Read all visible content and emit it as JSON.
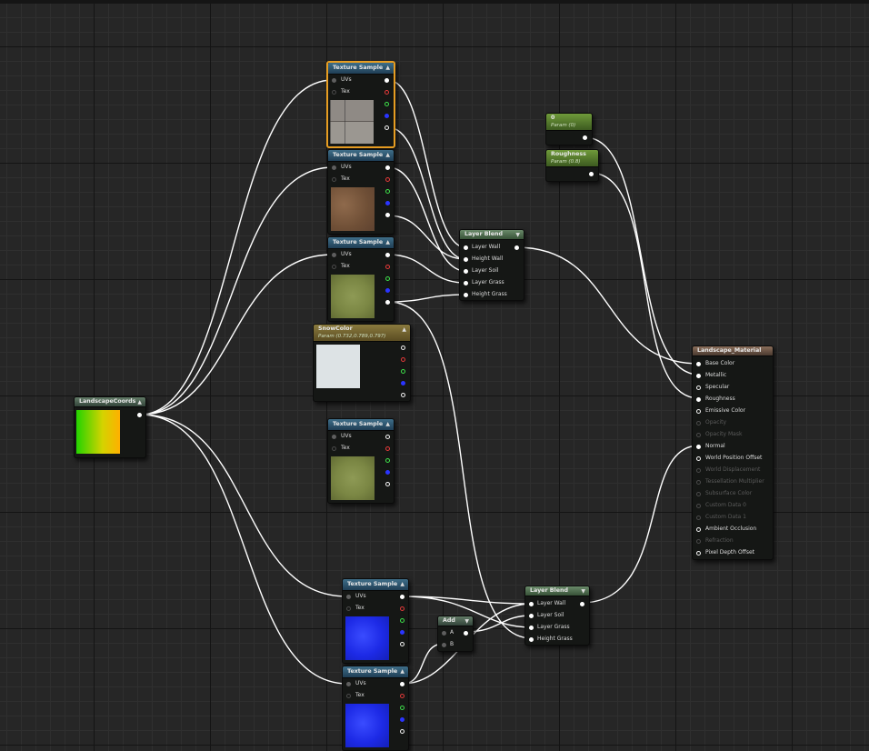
{
  "nodes": {
    "landscape_coords": {
      "title": "LandscapeCoords"
    },
    "texture_sample_label": "Texture Sample",
    "texture_pins": {
      "uvs": "UVs",
      "tex": "Tex"
    },
    "snow_color": {
      "title": "SnowColor",
      "subtitle": "Param (0.732,0.789,0.797)"
    },
    "param_0": {
      "title": "0",
      "subtitle": "Param (0)"
    },
    "roughness": {
      "title": "Roughness",
      "subtitle": "Param (0.8)"
    },
    "layer_blend_top": {
      "title": "Layer Blend",
      "inputs": [
        "Layer Wall",
        "Height Wall",
        "Layer Soil",
        "Layer Grass",
        "Height Grass"
      ]
    },
    "layer_blend_bottom": {
      "title": "Layer Blend",
      "inputs": [
        "Layer Wall",
        "Layer Soil",
        "Layer Grass",
        "Height Grass"
      ]
    },
    "add": {
      "title": "Add",
      "inputs": [
        "A",
        "B"
      ]
    },
    "landscape_material": {
      "title": "Landscape_Material",
      "inputs": [
        {
          "label": "Base Color",
          "active": true
        },
        {
          "label": "Metallic",
          "active": true
        },
        {
          "label": "Specular",
          "active": true
        },
        {
          "label": "Roughness",
          "active": true
        },
        {
          "label": "Emissive Color",
          "active": true
        },
        {
          "label": "Opacity",
          "active": false
        },
        {
          "label": "Opacity Mask",
          "active": false
        },
        {
          "label": "Normal",
          "active": true
        },
        {
          "label": "World Position Offset",
          "active": true
        },
        {
          "label": "World Displacement",
          "active": false
        },
        {
          "label": "Tessellation Multiplier",
          "active": false
        },
        {
          "label": "Subsurface Color",
          "active": false
        },
        {
          "label": "Custom Data 0",
          "active": false
        },
        {
          "label": "Custom Data 1",
          "active": false
        },
        {
          "label": "Ambient Occlusion",
          "active": true
        },
        {
          "label": "Refraction",
          "active": false
        },
        {
          "label": "Pixel Depth Offset",
          "active": true
        }
      ]
    }
  },
  "textures": [
    "stone",
    "soil",
    "grass",
    "snow",
    "grass",
    "water",
    "water"
  ],
  "colors": {
    "canvas": "#262626",
    "selection": "#e79d22",
    "wire": "#ffffff",
    "pin_red": "#e53a3a",
    "pin_green": "#3ee04a",
    "pin_blue": "#2a35ff"
  },
  "icons": [
    "collapse-arrow-icon",
    "pin-icon"
  ]
}
